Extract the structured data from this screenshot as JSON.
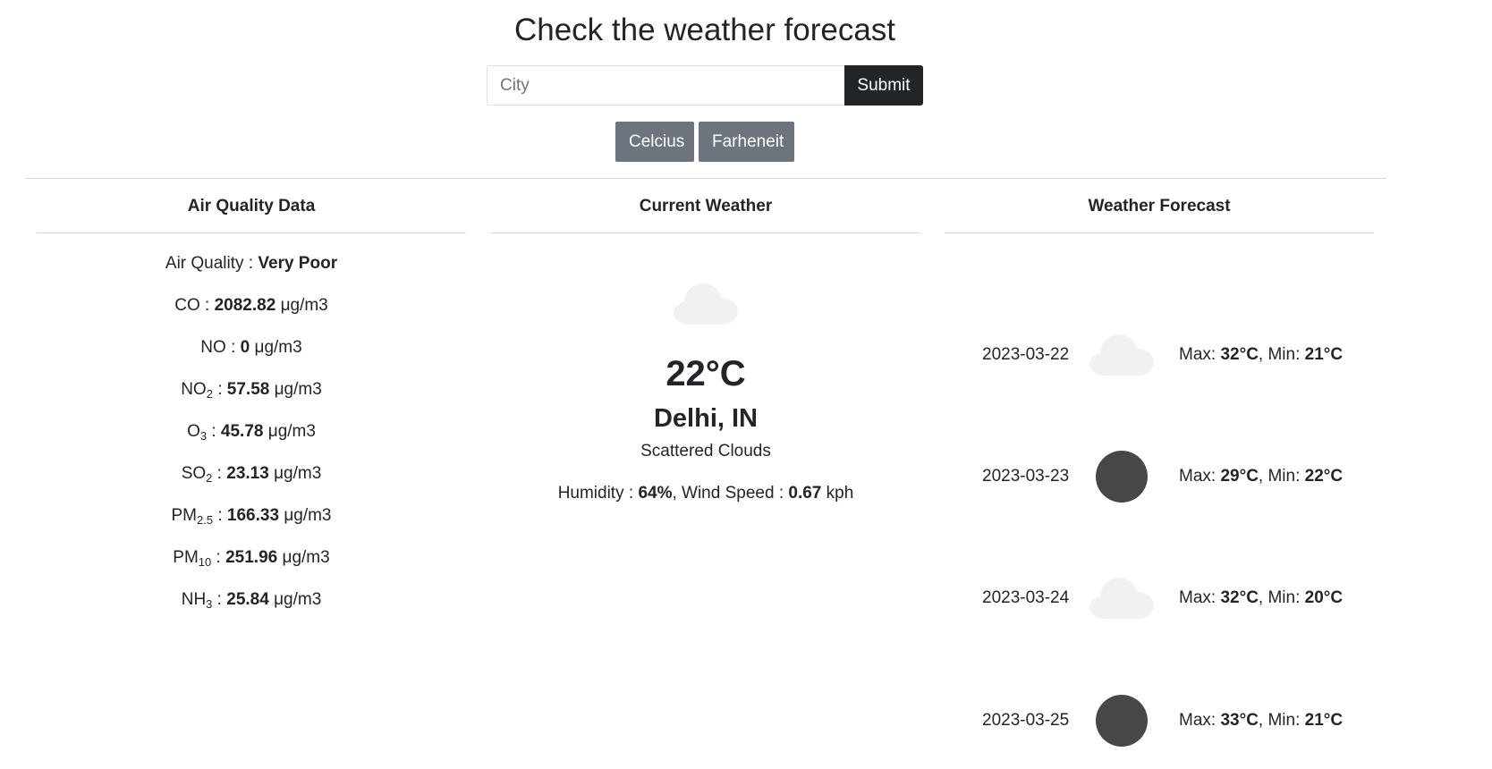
{
  "page": {
    "title": "Check the weather forecast"
  },
  "search": {
    "placeholder": "City",
    "value": "",
    "submit_label": "Submit"
  },
  "units": {
    "celsius_label": "Celcius",
    "fahrenheit_label": "Farheneit"
  },
  "air_quality": {
    "header": "Air Quality Data",
    "items": [
      {
        "label": "Air Quality",
        "sub": "",
        "value": "Very Poor",
        "unit": ""
      },
      {
        "label": "CO",
        "sub": "",
        "value": "2082.82",
        "unit": "μg/m3"
      },
      {
        "label": "NO",
        "sub": "",
        "value": "0",
        "unit": "μg/m3"
      },
      {
        "label": "NO",
        "sub": "2",
        "value": "57.58",
        "unit": "μg/m3"
      },
      {
        "label": "O",
        "sub": "3",
        "value": "45.78",
        "unit": "μg/m3"
      },
      {
        "label": "SO",
        "sub": "2",
        "value": "23.13",
        "unit": "μg/m3"
      },
      {
        "label": "PM",
        "sub": "2.5",
        "value": "166.33",
        "unit": "μg/m3"
      },
      {
        "label": "PM",
        "sub": "10",
        "value": "251.96",
        "unit": "μg/m3"
      },
      {
        "label": "NH",
        "sub": "3",
        "value": "25.84",
        "unit": "μg/m3"
      }
    ]
  },
  "current": {
    "header": "Current Weather",
    "icon": "cloud-icon",
    "temperature": "22°C",
    "location": "Delhi, IN",
    "description": "Scattered Clouds",
    "humidity_label": "Humidity :",
    "humidity_value": "64%",
    "wind_label": "Wind Speed :",
    "wind_value": "0.67",
    "wind_unit": "kph"
  },
  "forecast": {
    "header": "Weather Forecast",
    "days": [
      {
        "date": "2023-03-22",
        "icon": "cloud-icon",
        "max": "32°C",
        "min": "21°C"
      },
      {
        "date": "2023-03-23",
        "icon": "moon-icon",
        "max": "29°C",
        "min": "22°C"
      },
      {
        "date": "2023-03-24",
        "icon": "cloud-icon",
        "max": "32°C",
        "min": "20°C"
      },
      {
        "date": "2023-03-25",
        "icon": "moon-icon",
        "max": "33°C",
        "min": "21°C"
      }
    ],
    "max_label": "Max:",
    "min_label": "Min:"
  },
  "colors": {
    "dark_button": "#212529",
    "unit_button": "#6c757d",
    "cloud": "#f1f1f1",
    "moon": "#474747",
    "divider": "#d6d8db"
  }
}
